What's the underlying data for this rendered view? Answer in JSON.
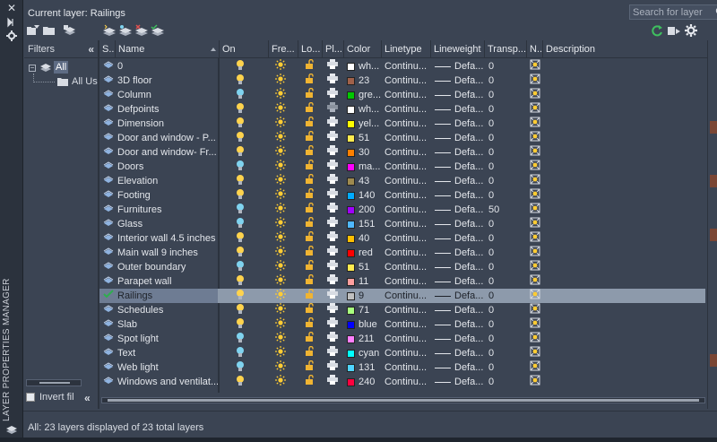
{
  "window": {
    "vertical_title": "LAYER PROPERTIES MANAGER",
    "close_glyph": "✕",
    "current_layer_label": "Current layer: Railings",
    "search_placeholder": "Search for layer"
  },
  "filters": {
    "title": "Filters",
    "collapse_glyph": "«",
    "tree": [
      {
        "label": "All",
        "selected": true
      },
      {
        "label": "All Used Layers",
        "display": "All Use"
      }
    ],
    "invert_label": "Invert fil",
    "invert_checked": false
  },
  "columns": [
    "S...",
    "Name",
    "On",
    "Fre...",
    "Lo...",
    "Pl...",
    "Color",
    "Linetype",
    "Lineweight",
    "Transp...",
    "N...",
    "Description"
  ],
  "layers": [
    {
      "name": "0",
      "on": true,
      "color_name": "wh...",
      "color_hex": "#ffffff",
      "linetype": "Continu...",
      "lineweight": "Defa...",
      "transparency": "0"
    },
    {
      "name": "3D floor",
      "on": true,
      "color_name": "23",
      "color_hex": "#a0614a",
      "linetype": "Continu...",
      "lineweight": "Defa...",
      "transparency": "0"
    },
    {
      "name": "Column",
      "on": false,
      "color_name": "gre...",
      "color_hex": "#00c800",
      "linetype": "Continu...",
      "lineweight": "Defa...",
      "transparency": "0"
    },
    {
      "name": "Defpoints",
      "on": true,
      "color_name": "wh...",
      "color_hex": "#ffffff",
      "linetype": "Continu...",
      "lineweight": "Defa...",
      "transparency": "0",
      "plot_disabled": true
    },
    {
      "name": "Dimension",
      "on": true,
      "color_name": "yel...",
      "color_hex": "#ffff00",
      "linetype": "Continu...",
      "lineweight": "Defa...",
      "transparency": "0"
    },
    {
      "name": "Door and window - P...",
      "on": true,
      "color_name": "51",
      "color_hex": "#ffeb4f",
      "linetype": "Continu...",
      "lineweight": "Defa...",
      "transparency": "0"
    },
    {
      "name": "Door and window- Fr...",
      "on": true,
      "color_name": "30",
      "color_hex": "#ff8000",
      "linetype": "Continu...",
      "lineweight": "Defa...",
      "transparency": "0"
    },
    {
      "name": "Doors",
      "on": false,
      "color_name": "ma...",
      "color_hex": "#ff00ff",
      "linetype": "Continu...",
      "lineweight": "Defa...",
      "transparency": "0"
    },
    {
      "name": "Elevation",
      "on": true,
      "color_name": "43",
      "color_hex": "#9e8a4f",
      "linetype": "Continu...",
      "lineweight": "Defa...",
      "transparency": "0"
    },
    {
      "name": "Footing",
      "on": true,
      "color_name": "140",
      "color_hex": "#00aaff",
      "linetype": "Continu...",
      "lineweight": "Defa...",
      "transparency": "0"
    },
    {
      "name": "Furnitures",
      "on": false,
      "color_name": "200",
      "color_hex": "#a000ff",
      "linetype": "Continu...",
      "lineweight": "Defa...",
      "transparency": "50"
    },
    {
      "name": "Glass",
      "on": false,
      "color_name": "151",
      "color_hex": "#4fb8ff",
      "linetype": "Continu...",
      "lineweight": "Defa...",
      "transparency": "0"
    },
    {
      "name": "Interior wall 4.5 inches",
      "on": true,
      "color_name": "40",
      "color_hex": "#ffbf00",
      "linetype": "Continu...",
      "lineweight": "Defa...",
      "transparency": "0"
    },
    {
      "name": "Main wall 9 inches",
      "on": true,
      "color_name": "red",
      "color_hex": "#ff0000",
      "linetype": "Continu...",
      "lineweight": "Defa...",
      "transparency": "0"
    },
    {
      "name": "Outer boundary",
      "on": false,
      "color_name": "51",
      "color_hex": "#ffeb4f",
      "linetype": "Continu...",
      "lineweight": "Defa...",
      "transparency": "0"
    },
    {
      "name": "Parapet wall",
      "on": true,
      "color_name": "11",
      "color_hex": "#ff9f9f",
      "linetype": "Continu...",
      "lineweight": "Defa...",
      "transparency": "0"
    },
    {
      "name": "Railings",
      "on": true,
      "current": true,
      "selected": true,
      "color_name": "9",
      "color_hex": "#c0c0c0",
      "linetype": "Continu...",
      "lineweight": "Defa...",
      "transparency": "0"
    },
    {
      "name": "Schedules",
      "on": true,
      "color_name": "71",
      "color_hex": "#a8ff7f",
      "linetype": "Continu...",
      "lineweight": "Defa...",
      "transparency": "0"
    },
    {
      "name": "Slab",
      "on": true,
      "color_name": "blue",
      "color_hex": "#0000ff",
      "linetype": "Continu...",
      "lineweight": "Defa...",
      "transparency": "0"
    },
    {
      "name": "Spot light",
      "on": false,
      "color_name": "211",
      "color_hex": "#ff7fff",
      "linetype": "Continu...",
      "lineweight": "Defa...",
      "transparency": "0"
    },
    {
      "name": "Text",
      "on": false,
      "color_name": "cyan",
      "color_hex": "#00ffff",
      "linetype": "Continu...",
      "lineweight": "Defa...",
      "transparency": "0"
    },
    {
      "name": "Web light",
      "on": false,
      "color_name": "131",
      "color_hex": "#4fd4ff",
      "linetype": "Continu...",
      "lineweight": "Defa...",
      "transparency": "0"
    },
    {
      "name": "Windows and ventilat...",
      "on": true,
      "color_name": "240",
      "color_hex": "#ff003f",
      "linetype": "Continu...",
      "lineweight": "Defa...",
      "transparency": "0"
    }
  ],
  "status_text": "All: 23 layers displayed of 23 total layers",
  "colors": {
    "panel_bg": "#3b4453",
    "selection_row": "#8d9aab",
    "bulb_on": "#ffd34d",
    "bulb_off": "#7fd3ef",
    "sun": "#ffcc33",
    "lock": "#f0b432",
    "refresh_green": "#3fbf5f"
  },
  "icons": [
    "close-icon",
    "pin-icon",
    "settings-icon",
    "new-property-filter-icon",
    "new-group-filter-icon",
    "layer-states-manager-icon",
    "new-layer-icon",
    "new-layer-vp-frozen-icon",
    "delete-layer-icon",
    "set-current-icon",
    "search-icon",
    "refresh-icon",
    "settings-icon",
    "layer-status-icon",
    "lightbulb-icon",
    "sun-icon",
    "unlock-icon",
    "printer-icon",
    "new-vp-freeze-icon"
  ]
}
